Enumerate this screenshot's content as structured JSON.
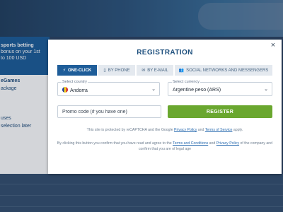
{
  "background": {
    "promo_lines": [
      "sports betting",
      "bonus on your 1st",
      "to 100 USD"
    ],
    "side_items": [
      "eGames",
      "ackage",
      "uses",
      "selection later"
    ]
  },
  "modal": {
    "title": "REGISTRATION",
    "close_icon": "×",
    "tabs": [
      {
        "label": "ONE-CLICK",
        "icon": "⚡",
        "active": true
      },
      {
        "label": "BY PHONE",
        "icon": "▯",
        "active": false
      },
      {
        "label": "BY E-MAIL",
        "icon": "✉",
        "active": false
      },
      {
        "label": "SOCIAL NETWORKS AND MESSENGERS",
        "icon": "👥",
        "active": false
      }
    ],
    "country": {
      "label": "Select country",
      "value": "Andorra"
    },
    "currency": {
      "label": "Select currency",
      "value": "Argentine peso (ARS)"
    },
    "promo_placeholder": "Promo code (if you have one)",
    "register_label": "REGISTER",
    "recaptcha": {
      "text1": "This site is protected by reCAPTCHA and the Google ",
      "privacy": "Privacy Policy",
      "and": " and ",
      "terms": "Terms of Service",
      "apply": " apply."
    },
    "consent": {
      "text1": "By clicking this button you confirm that you have read and agree to the ",
      "terms": "Terms and Conditions",
      "and": " and ",
      "privacy": "Privacy Policy",
      "text2": " of the company and confirm that you are of legal age"
    }
  },
  "colors": {
    "accent": "#1e5d99",
    "register": "#6aa72f",
    "title": "#1d4f7d"
  }
}
